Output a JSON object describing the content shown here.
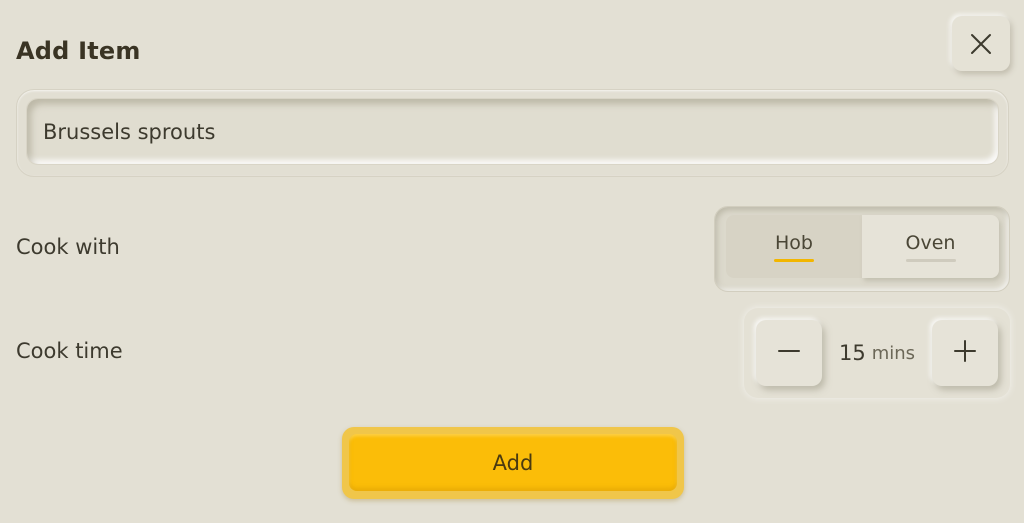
{
  "dialog": {
    "title": "Add Item",
    "close_icon": "close-icon"
  },
  "item_input": {
    "value": "Brussels sprouts"
  },
  "cook_with": {
    "label": "Cook with",
    "options": [
      "Hob",
      "Oven"
    ],
    "selected": "Hob",
    "accent_color": "#f2b600"
  },
  "cook_time": {
    "label": "Cook time",
    "value": "15",
    "unit": "mins",
    "decrement_icon": "minus-icon",
    "increment_icon": "plus-icon"
  },
  "add_button": {
    "label": "Add",
    "color": "#fbbd08"
  }
}
